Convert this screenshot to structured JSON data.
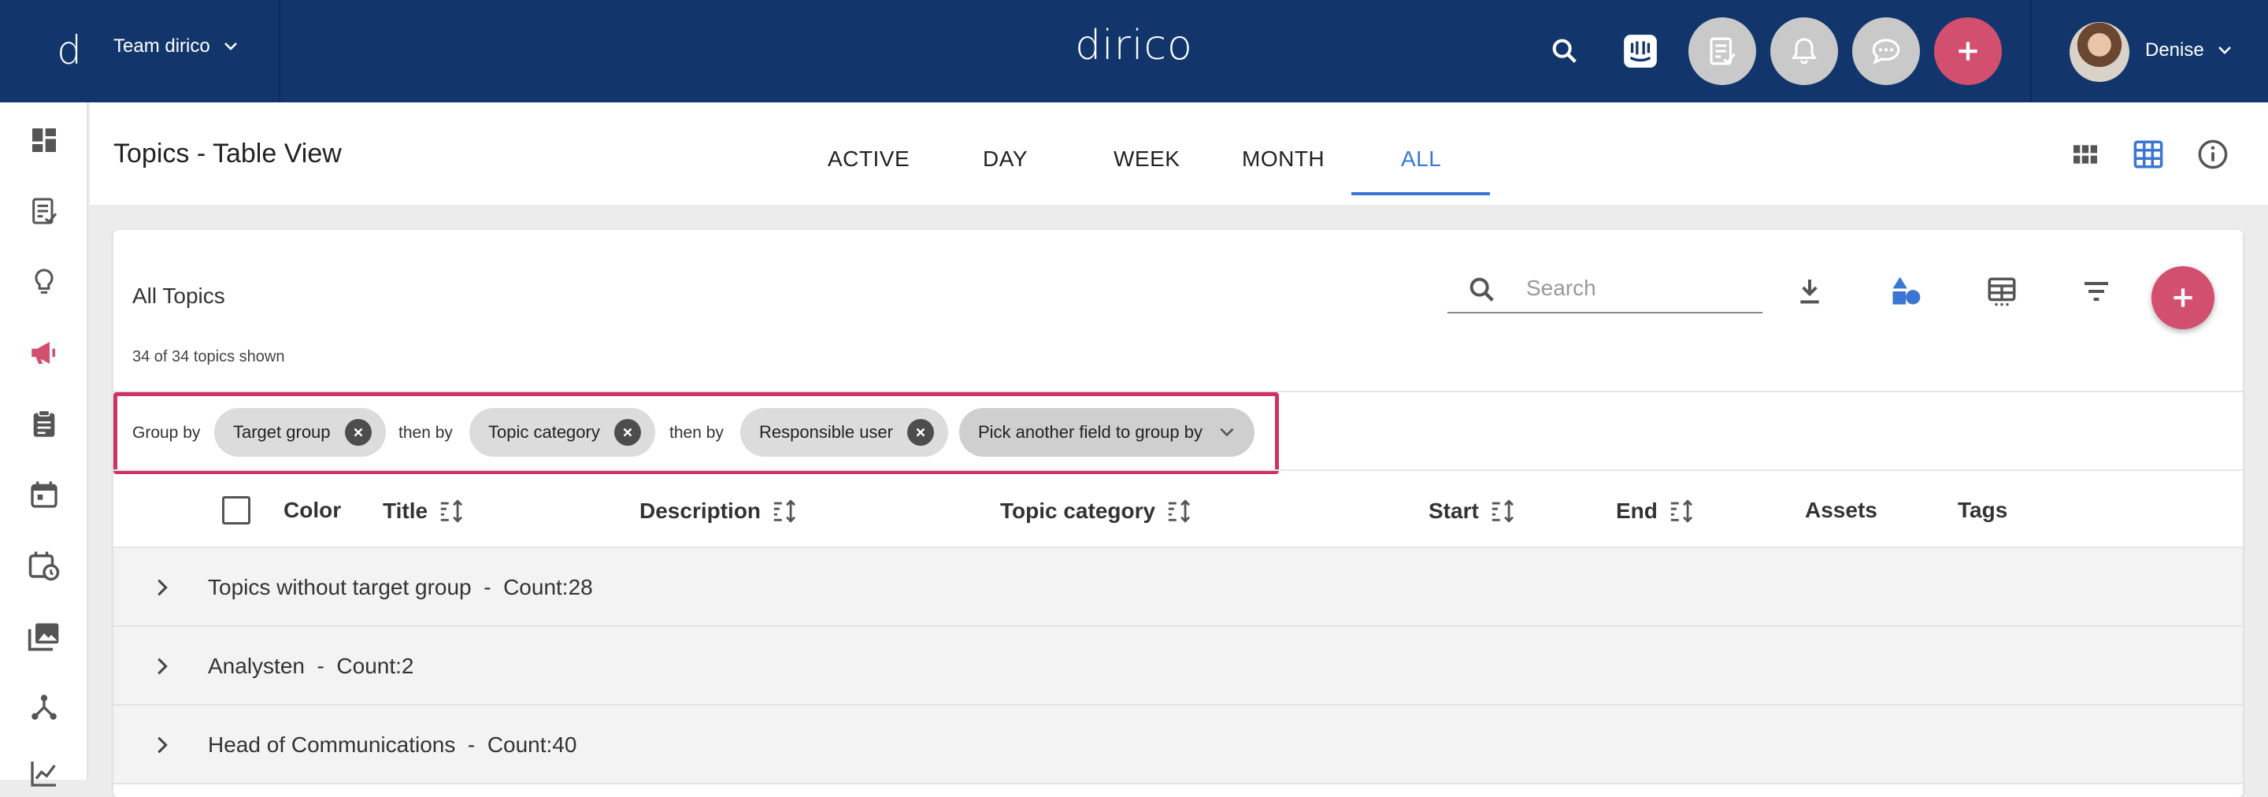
{
  "colors": {
    "topbar": "#12366b",
    "accent_pink": "#d34f6f",
    "active_tab": "#3b76d4",
    "highlight_border": "#cc3360"
  },
  "topbar": {
    "brand_mark": "d",
    "team_name": "Team dirico",
    "logo": "dirico",
    "user_name": "Denise",
    "icons": [
      "search-icon",
      "intercom-icon",
      "review-icon",
      "bell-icon",
      "chat-icon",
      "add-icon"
    ]
  },
  "sidebar": {
    "items": [
      "dashboard-icon",
      "tasks-icon",
      "ideas-icon",
      "campaigns-icon",
      "clipboard-icon",
      "calendar-icon",
      "schedule-icon",
      "media-icon",
      "network-icon",
      "analytics-icon"
    ]
  },
  "header": {
    "title": "Topics - Table View",
    "tabs": [
      {
        "label": "ACTIVE",
        "active": false
      },
      {
        "label": "DAY",
        "active": false
      },
      {
        "label": "WEEK",
        "active": false
      },
      {
        "label": "MONTH",
        "active": false
      },
      {
        "label": "ALL",
        "active": true
      }
    ]
  },
  "card": {
    "title": "All Topics",
    "subtitle": "34 of 34 topics shown",
    "search_placeholder": "Search"
  },
  "groupby": {
    "label": "Group by",
    "then_label": "then by",
    "chips": [
      "Target group",
      "Topic category",
      "Responsible user"
    ],
    "pick_label": "Pick another field to group by"
  },
  "table": {
    "columns": [
      "Color",
      "Title",
      "Description",
      "Topic category",
      "Start",
      "End",
      "Assets",
      "Tags"
    ],
    "groups": [
      "Topics without target group  -  Count:28",
      "Analysten  -  Count:2",
      "Head of Communications  -  Count:40"
    ]
  }
}
